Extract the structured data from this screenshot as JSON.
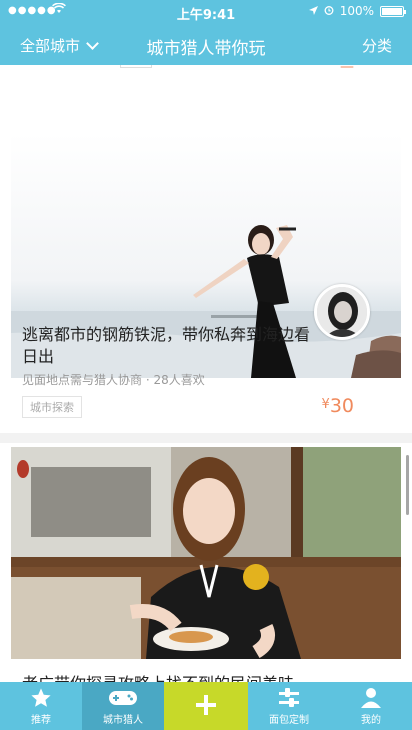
{
  "status_bar": {
    "signal": "●●●●●",
    "time": "上午9:41",
    "battery_percent": "100%",
    "battery_level": 1.0
  },
  "nav": {
    "city_selector": "全部城市",
    "title": "城市猎人带你玩",
    "category": "分类"
  },
  "feed": {
    "cards": [
      {
        "title": "逃离都市的钢筋铁泥，带你私奔到海边看日出",
        "meta": "见面地点需与猎人协商 · 28人喜欢",
        "tag": "城市探索",
        "currency": "¥",
        "price": "30"
      },
      {
        "title": "老广带你探寻攻略上找不到的民间美味"
      }
    ]
  },
  "tabbar": {
    "items": [
      {
        "label": "推荐",
        "icon": "star-icon"
      },
      {
        "label": "城市猎人",
        "icon": "gamepad-icon"
      },
      {
        "label": "",
        "icon": "plus-icon"
      },
      {
        "label": "面包定制",
        "icon": "sliders-icon"
      },
      {
        "label": "我的",
        "icon": "person-icon"
      }
    ]
  },
  "colors": {
    "primary": "#5ec3df",
    "active_tab": "#4aa8c4",
    "plus_tab": "#c7d929",
    "price": "#f08a5d"
  }
}
